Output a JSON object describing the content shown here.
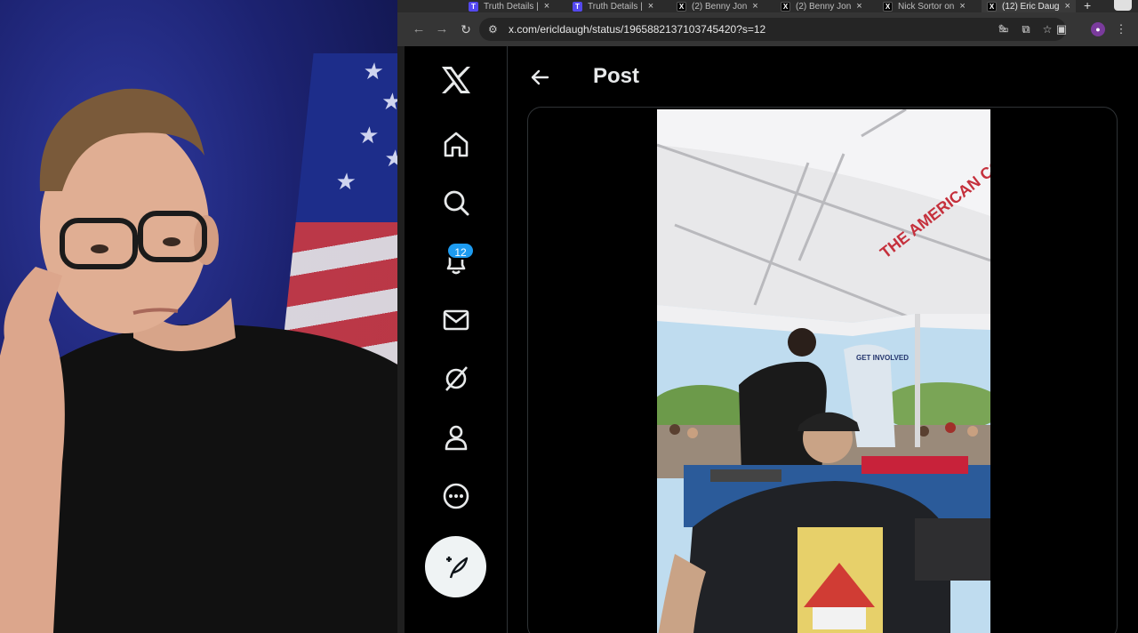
{
  "browser": {
    "tabs": [
      {
        "title": "Truth Details |",
        "favicon": "truth-favicon"
      },
      {
        "title": "Truth Details |",
        "favicon": "truth-favicon"
      },
      {
        "title": "(2) Benny Jon",
        "favicon": "x-favicon"
      },
      {
        "title": "(2) Benny Jon",
        "favicon": "x-favicon"
      },
      {
        "title": "Nick Sortor on",
        "favicon": "x-favicon"
      },
      {
        "title": "(12) Eric Daug",
        "favicon": "x-favicon",
        "active": true
      }
    ],
    "tab_close": "×",
    "new_tab": "+",
    "url": "x.com/ericldaugh/status/1965882137103745420?s=12"
  },
  "x": {
    "logo": "𝕏",
    "notifications_count": "12",
    "page_title": "Post",
    "nav": [
      "home-icon",
      "search-icon",
      "bell-icon",
      "mail-icon",
      "grok-icon",
      "profile-icon",
      "more-icon"
    ]
  },
  "video": {
    "tent_text": "THE AMERICAN COMEBACK",
    "banner_text": "GET INVOLVED"
  },
  "colors": {
    "accent": "#1d9bf0",
    "background": "#000000",
    "text": "#e7e9ea",
    "border": "#2f3336"
  }
}
